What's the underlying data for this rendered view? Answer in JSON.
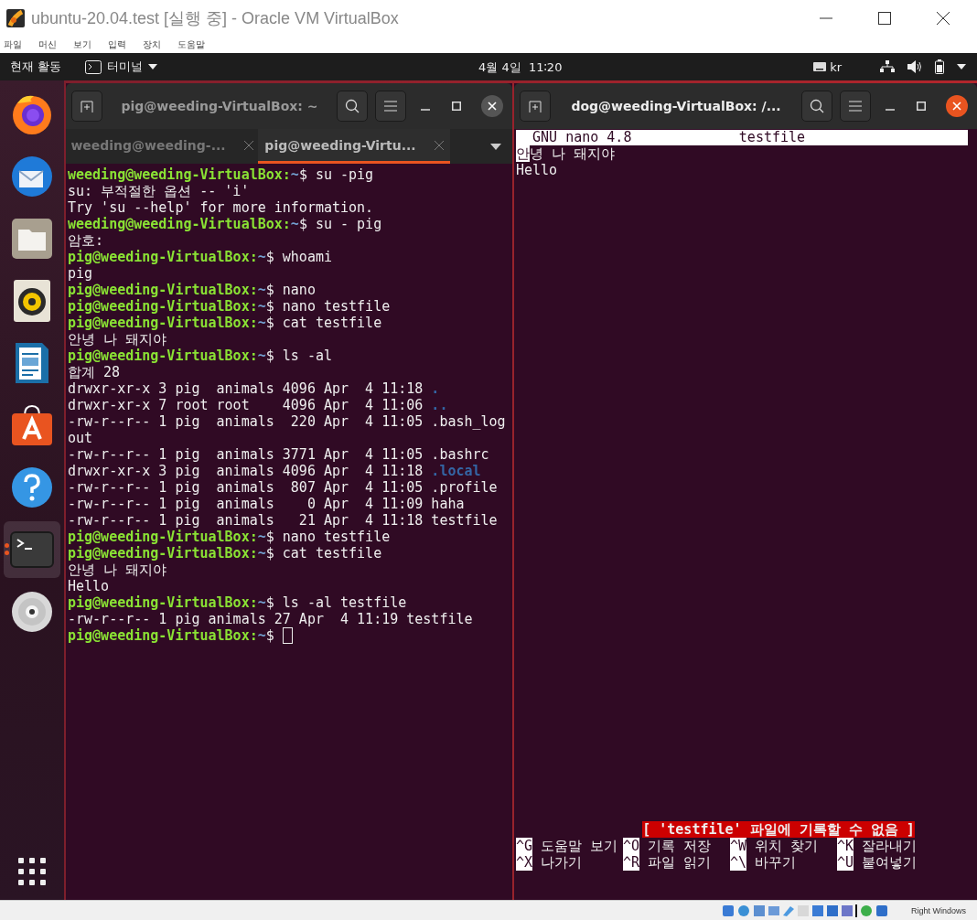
{
  "vbox": {
    "title": "ubuntu-20.04.test [실행 중] - Oracle VM VirtualBox",
    "menu": [
      "파일",
      "머신",
      "보기",
      "입력",
      "장치",
      "도움말"
    ]
  },
  "topbar": {
    "activities": "현재 활동",
    "app": "터미널",
    "clock": "4월 4일  11∶20",
    "keyboard": "kr"
  },
  "dock": [
    {
      "kind": "firefox",
      "running": false
    },
    {
      "kind": "mail",
      "running": false
    },
    {
      "kind": "files",
      "running": false
    },
    {
      "kind": "music",
      "running": false
    },
    {
      "kind": "writer",
      "running": false
    },
    {
      "kind": "store",
      "running": false
    },
    {
      "kind": "help",
      "running": false
    },
    {
      "kind": "terminal",
      "running": true
    },
    {
      "kind": "disc",
      "running": false
    }
  ],
  "windows": [
    {
      "kind": "shell",
      "title": "pig@weeding-VirtualBox: ~",
      "focused": false,
      "tabs": [
        {
          "label": "weeding@weeding-...",
          "selected": false
        },
        {
          "label": "pig@weeding-Virtu...",
          "selected": true
        }
      ],
      "lines": [
        {
          "segments": [
            {
              "kind": "user",
              "text": "weeding@weeding-VirtualBox:"
            },
            {
              "kind": "path",
              "text": "~"
            },
            {
              "kind": "text",
              "text": "$ su -pig"
            }
          ]
        },
        {
          "segments": [
            {
              "kind": "text",
              "text": "su: 부적절한 옵션 -- 'i'"
            }
          ]
        },
        {
          "segments": [
            {
              "kind": "text",
              "text": "Try 'su --help' for more information."
            }
          ]
        },
        {
          "segments": [
            {
              "kind": "user",
              "text": "weeding@weeding-VirtualBox:"
            },
            {
              "kind": "path",
              "text": "~"
            },
            {
              "kind": "text",
              "text": "$ su - pig"
            }
          ]
        },
        {
          "segments": [
            {
              "kind": "text",
              "text": "암호:"
            }
          ]
        },
        {
          "segments": [
            {
              "kind": "user",
              "text": "pig@weeding-VirtualBox:"
            },
            {
              "kind": "path",
              "text": "~"
            },
            {
              "kind": "text",
              "text": "$ whoami"
            }
          ]
        },
        {
          "segments": [
            {
              "kind": "text",
              "text": "pig"
            }
          ]
        },
        {
          "segments": [
            {
              "kind": "user",
              "text": "pig@weeding-VirtualBox:"
            },
            {
              "kind": "path",
              "text": "~"
            },
            {
              "kind": "text",
              "text": "$ nano"
            }
          ]
        },
        {
          "segments": [
            {
              "kind": "user",
              "text": "pig@weeding-VirtualBox:"
            },
            {
              "kind": "path",
              "text": "~"
            },
            {
              "kind": "text",
              "text": "$ nano testfile"
            }
          ]
        },
        {
          "segments": [
            {
              "kind": "user",
              "text": "pig@weeding-VirtualBox:"
            },
            {
              "kind": "path",
              "text": "~"
            },
            {
              "kind": "text",
              "text": "$ cat testfile"
            }
          ]
        },
        {
          "segments": [
            {
              "kind": "text",
              "text": "안녕 나 돼지야"
            }
          ]
        },
        {
          "segments": [
            {
              "kind": "user",
              "text": "pig@weeding-VirtualBox:"
            },
            {
              "kind": "path",
              "text": "~"
            },
            {
              "kind": "text",
              "text": "$ ls -al"
            }
          ]
        },
        {
          "segments": [
            {
              "kind": "text",
              "text": "합계 28"
            }
          ]
        },
        {
          "segments": [
            {
              "kind": "text",
              "text": "drwxr-xr-x 3 pig  animals 4096 Apr  4 11:18 "
            },
            {
              "kind": "dir",
              "text": "."
            }
          ]
        },
        {
          "segments": [
            {
              "kind": "text",
              "text": "drwxr-xr-x 7 root root    4096 Apr  4 11:06 "
            },
            {
              "kind": "dir",
              "text": ".."
            }
          ]
        },
        {
          "segments": [
            {
              "kind": "text",
              "text": "-rw-r--r-- 1 pig  animals  220 Apr  4 11:05 .bash_log"
            }
          ]
        },
        {
          "segments": [
            {
              "kind": "text",
              "text": "out"
            }
          ]
        },
        {
          "segments": [
            {
              "kind": "text",
              "text": "-rw-r--r-- 1 pig  animals 3771 Apr  4 11:05 .bashrc"
            }
          ]
        },
        {
          "segments": [
            {
              "kind": "text",
              "text": "drwxr-xr-x 3 pig  animals 4096 Apr  4 11:18 "
            },
            {
              "kind": "dir",
              "text": ".local"
            }
          ]
        },
        {
          "segments": [
            {
              "kind": "text",
              "text": "-rw-r--r-- 1 pig  animals  807 Apr  4 11:05 .profile"
            }
          ]
        },
        {
          "segments": [
            {
              "kind": "text",
              "text": "-rw-r--r-- 1 pig  animals    0 Apr  4 11:09 haha"
            }
          ]
        },
        {
          "segments": [
            {
              "kind": "text",
              "text": "-rw-r--r-- 1 pig  animals   21 Apr  4 11:18 testfile"
            }
          ]
        },
        {
          "segments": [
            {
              "kind": "user",
              "text": "pig@weeding-VirtualBox:"
            },
            {
              "kind": "path",
              "text": "~"
            },
            {
              "kind": "text",
              "text": "$ nano testfile"
            }
          ]
        },
        {
          "segments": [
            {
              "kind": "user",
              "text": "pig@weeding-VirtualBox:"
            },
            {
              "kind": "path",
              "text": "~"
            },
            {
              "kind": "text",
              "text": "$ cat testfile"
            }
          ]
        },
        {
          "segments": [
            {
              "kind": "text",
              "text": "안녕 나 돼지야"
            }
          ]
        },
        {
          "segments": [
            {
              "kind": "text",
              "text": "Hello"
            }
          ]
        },
        {
          "segments": [
            {
              "kind": "user",
              "text": "pig@weeding-VirtualBox:"
            },
            {
              "kind": "path",
              "text": "~"
            },
            {
              "kind": "text",
              "text": "$ ls -al testfile"
            }
          ]
        },
        {
          "segments": [
            {
              "kind": "text",
              "text": "-rw-r--r-- 1 pig animals 27 Apr  4 11:19 testfile"
            }
          ]
        },
        {
          "segments": [
            {
              "kind": "user",
              "text": "pig@weeding-VirtualBox:"
            },
            {
              "kind": "path",
              "text": "~"
            },
            {
              "kind": "text",
              "text": "$"
            }
          ],
          "cursor": true
        }
      ]
    },
    {
      "kind": "nano",
      "title": "dog@weeding-VirtualBox: /...",
      "focused": true,
      "nano_title": "  GNU nano 4.8             testfile",
      "lines": [
        {
          "segments": [
            {
              "kind": "cursor",
              "text": "안"
            },
            {
              "kind": "text",
              "text": "녕 나 돼지야"
            }
          ]
        },
        {
          "segments": [
            {
              "kind": "text",
              "text": "Hello"
            }
          ]
        }
      ],
      "status": "[ 'testfile' 파일에 기록할 수 없음 ]",
      "shortcuts": [
        [
          {
            "key": "^G",
            "label": "도움말 보기"
          },
          {
            "key": "^O",
            "label": "기록 저장"
          },
          {
            "key": "^W",
            "label": "위치 찾기"
          },
          {
            "key": "^K",
            "label": "잘라내기"
          }
        ],
        [
          {
            "key": "^X",
            "label": "나가기"
          },
          {
            "key": "^R",
            "label": "파일 읽기"
          },
          {
            "key": "^\\",
            "label": "바꾸기"
          },
          {
            "key": "^U",
            "label": "붙여넣기"
          }
        ]
      ]
    }
  ],
  "statusbar": {
    "host_key": "Right Windows"
  }
}
